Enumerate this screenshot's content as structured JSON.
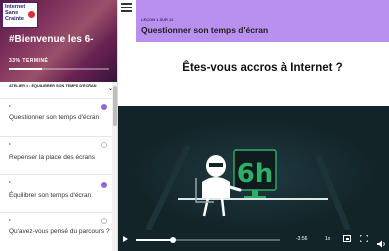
{
  "sidebar": {
    "logo_lines": [
      "Internet",
      "Sans",
      "Crainte"
    ],
    "hero_title": "#Bienvenue les 6-",
    "progress_text": "33% TERMINÉ",
    "progress_fraction": 0.33,
    "section_title": "ATELIER 1 : ÉQUILIBRER SON TEMPS D'ÉCRAN",
    "lessons": [
      {
        "label": "Questionner son temps d'écran",
        "status": "done"
      },
      {
        "label": "Repenser la place des écrans",
        "status": "todo"
      },
      {
        "label": "Équilibrer son temps d'écran",
        "status": "done"
      },
      {
        "label": "Qu'avez-vous pensé du parcours ?",
        "status": "todo"
      }
    ]
  },
  "header": {
    "lesson_count": "LEÇON 1 SUR 12",
    "lesson_title": "Questionner son temps d'écran"
  },
  "main": {
    "headline": "Êtes-vous accros à Internet ?"
  },
  "video": {
    "time": "-3:56",
    "speed": "1x",
    "progress_fraction": 0.26,
    "colors": {
      "background": "#132429",
      "accent": "#2fae68"
    }
  }
}
